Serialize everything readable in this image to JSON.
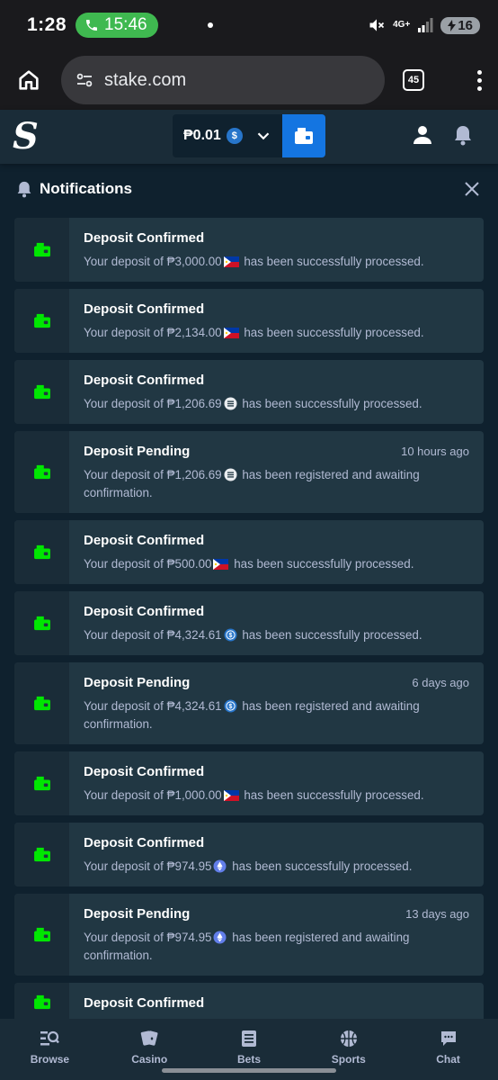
{
  "status_bar": {
    "time": "1:28",
    "call_timer": "15:46",
    "network": "4G+",
    "battery": "16"
  },
  "browser": {
    "url": "stake.com",
    "tab_count": "45"
  },
  "header": {
    "logo": "S",
    "balance": "₱0.01",
    "currency_icon": "usdc-coin-icon",
    "accent_color": "#1475e1"
  },
  "notifications": {
    "title": "Notifications",
    "items": [
      {
        "title": "Deposit Confirmed",
        "time": "",
        "prefix": "Your deposit of ",
        "amount": "₱3,000.00",
        "currency": "php-flag",
        "suffix": " has been successfully processed."
      },
      {
        "title": "Deposit Confirmed",
        "time": "",
        "prefix": "Your deposit of ",
        "amount": "₱2,134.00",
        "currency": "php-flag",
        "suffix": " has been successfully processed."
      },
      {
        "title": "Deposit Confirmed",
        "time": "",
        "prefix": "Your deposit of ",
        "amount": "₱1,206.69",
        "currency": "usde-coin",
        "suffix": " has been successfully processed."
      },
      {
        "title": "Deposit Pending",
        "time": "10 hours ago",
        "prefix": "Your deposit of ",
        "amount": "₱1,206.69",
        "currency": "usde-coin",
        "suffix": " has been registered and awaiting confirmation."
      },
      {
        "title": "Deposit Confirmed",
        "time": "",
        "prefix": "Your deposit of ",
        "amount": "₱500.00",
        "currency": "php-flag",
        "suffix": " has been successfully processed."
      },
      {
        "title": "Deposit Confirmed",
        "time": "",
        "prefix": "Your deposit of ",
        "amount": "₱4,324.61",
        "currency": "usdc-coin",
        "suffix": " has been successfully processed."
      },
      {
        "title": "Deposit Pending",
        "time": "6 days ago",
        "prefix": "Your deposit of ",
        "amount": "₱4,324.61",
        "currency": "usdc-coin",
        "suffix": " has been registered and awaiting confirmation."
      },
      {
        "title": "Deposit Confirmed",
        "time": "",
        "prefix": "Your deposit of ",
        "amount": "₱1,000.00",
        "currency": "php-flag",
        "suffix": " has been successfully processed."
      },
      {
        "title": "Deposit Confirmed",
        "time": "",
        "prefix": "Your deposit of ",
        "amount": "₱974.95",
        "currency": "eth-coin",
        "suffix": " has been successfully processed."
      },
      {
        "title": "Deposit Pending",
        "time": "13 days ago",
        "prefix": "Your deposit of ",
        "amount": "₱974.95",
        "currency": "eth-coin",
        "suffix": " has been registered and awaiting confirmation."
      },
      {
        "title": "Deposit Confirmed",
        "time": "",
        "prefix": "",
        "amount": "",
        "currency": "",
        "suffix": ""
      }
    ]
  },
  "bottom_nav": [
    {
      "label": "Browse",
      "icon": "browse-icon"
    },
    {
      "label": "Casino",
      "icon": "casino-cards-icon"
    },
    {
      "label": "Bets",
      "icon": "bets-list-icon"
    },
    {
      "label": "Sports",
      "icon": "sports-ball-icon"
    },
    {
      "label": "Chat",
      "icon": "chat-icon"
    }
  ],
  "colors": {
    "background": "#0f212e",
    "card": "#213743",
    "wallet_icon": "#00e701",
    "muted_text": "#b1bad3"
  }
}
